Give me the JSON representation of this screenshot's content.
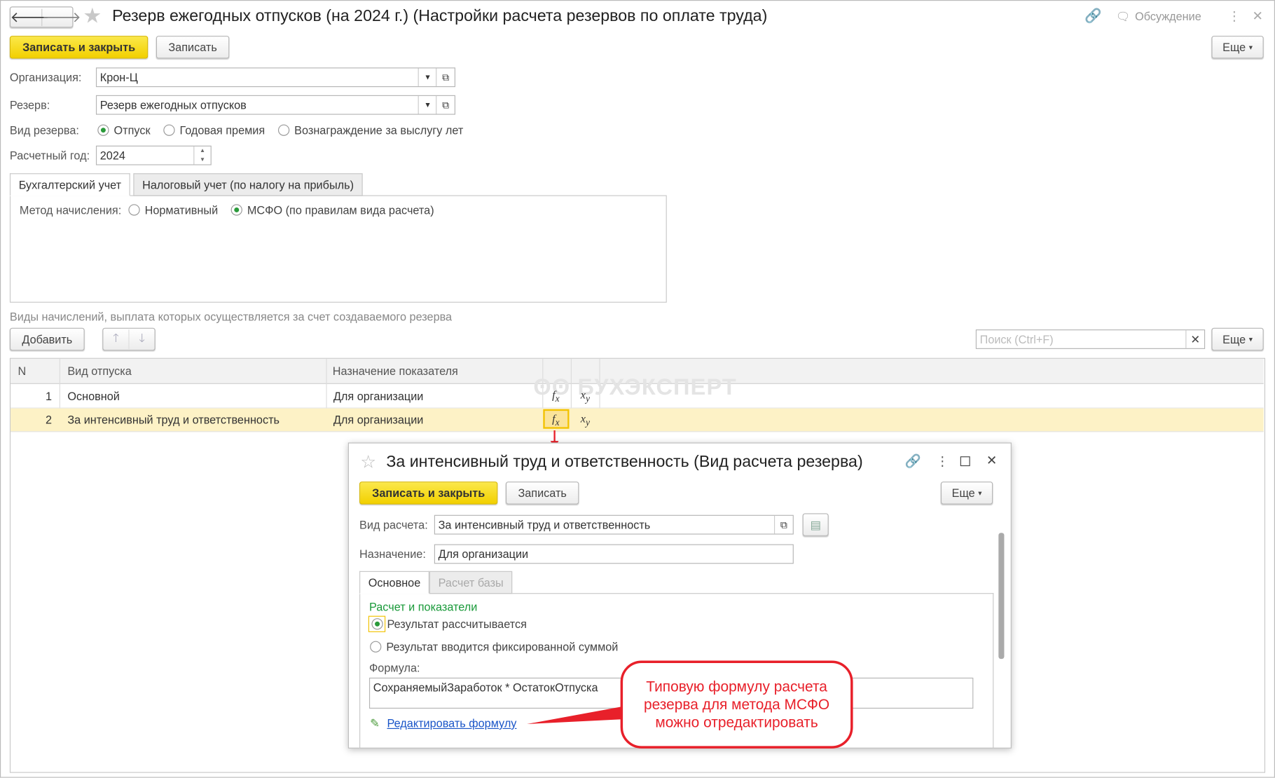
{
  "window": {
    "title": "Резерв ежегодных отпусков (на 2024 г.) (Настройки расчета резервов по оплате труда)",
    "discussion_label": "Обсуждение"
  },
  "toolbar": {
    "save_close_label": "Записать и закрыть",
    "save_label": "Записать",
    "more_label": "Еще"
  },
  "form": {
    "org_label": "Организация:",
    "org_value": "Крон-Ц",
    "reserve_label": "Резерв:",
    "reserve_value": "Резерв ежегодных отпусков",
    "kind_label": "Вид резерва:",
    "kind_options": [
      "Отпуск",
      "Годовая премия",
      "Вознаграждение за выслугу лет"
    ],
    "kind_selected": 0,
    "year_label": "Расчетный год:",
    "year_value": "2024"
  },
  "tabs": [
    "Бухгалтерский учет",
    "Налоговый учет (по налогу на прибыль)"
  ],
  "method": {
    "label": "Метод начисления:",
    "options": [
      "Нормативный",
      "МСФО (по правилам вида расчета)"
    ],
    "selected": 1
  },
  "accruals": {
    "caption": "Виды начислений, выплата которых осуществляется за счет создаваемого резерва",
    "add_label": "Добавить",
    "search_placeholder": "Поиск (Ctrl+F)",
    "more_label": "Еще"
  },
  "table": {
    "columns": [
      "N",
      "Вид отпуска",
      "Назначение показателя"
    ],
    "rows": [
      {
        "n": "1",
        "kind": "Основной",
        "purpose": "Для организации"
      },
      {
        "n": "2",
        "kind": "За интенсивный труд и ответственность",
        "purpose": "Для организации"
      }
    ]
  },
  "watermark": "БУХЭКСПЕРТ",
  "dialog": {
    "title": "За интенсивный труд и ответственность (Вид расчета резерва)",
    "save_close_label": "Записать и закрыть",
    "save_label": "Записать",
    "more_label": "Еще",
    "calc_label": "Вид расчета:",
    "calc_value": "За интенсивный труд и ответственность",
    "purpose_label": "Назначение:",
    "purpose_value": "Для организации",
    "tabs": [
      "Основное",
      "Расчет базы"
    ],
    "section": "Расчет и показатели",
    "options": [
      "Результат рассчитывается",
      "Результат вводится фиксированной суммой"
    ],
    "formula_label": "Формула:",
    "formula_value": "СохраняемыйЗаработок * ОстатокОтпуска",
    "edit_link": "Редактировать формулу"
  },
  "callout": "Типовую формулу расчета резерва для метода МСФО можно отредактировать",
  "colors": {
    "accent": "#f2d000",
    "callout": "#e8202a",
    "selected_row": "#fdf2c6",
    "section": "#1a9a3a",
    "link": "#1a55c8"
  }
}
